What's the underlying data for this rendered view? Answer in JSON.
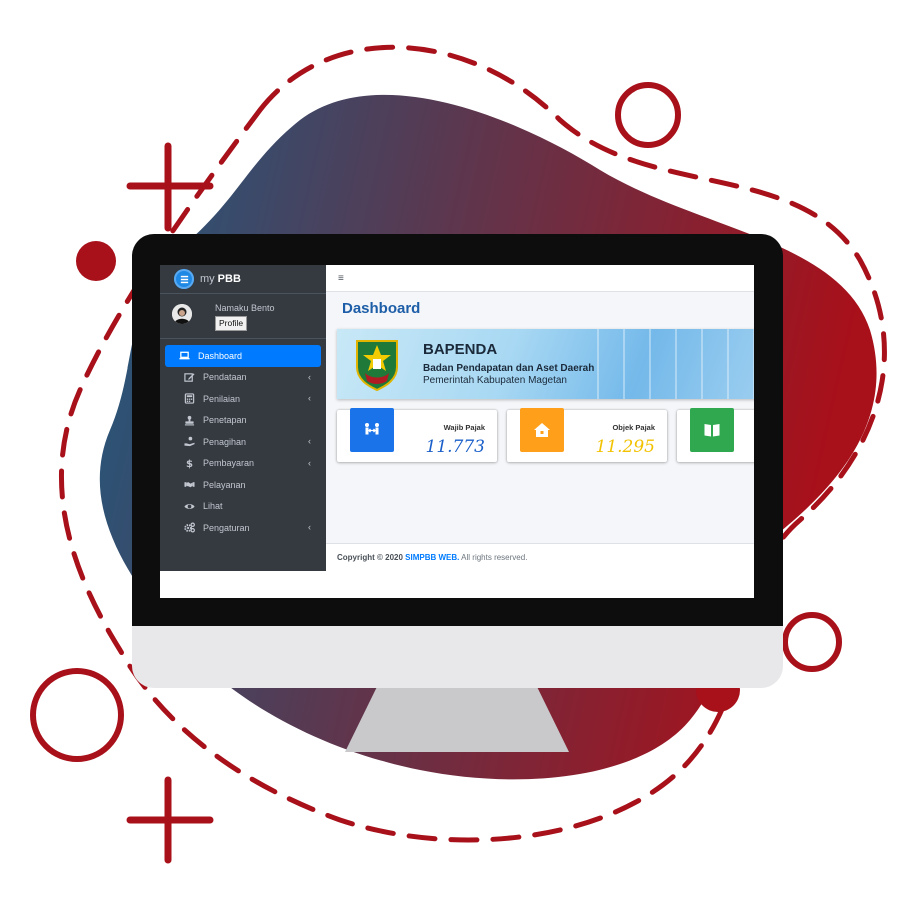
{
  "brand": {
    "prefix": "my",
    "name": "PBB"
  },
  "user": {
    "name": "Namaku Bento",
    "profile_label": "Profile"
  },
  "menu": [
    {
      "label": "Dashboard",
      "icon": "laptop-icon",
      "active": true,
      "chevron": false
    },
    {
      "label": "Pendataan",
      "icon": "edit-icon",
      "active": false,
      "chevron": true
    },
    {
      "label": "Penilaian",
      "icon": "calculator-icon",
      "active": false,
      "chevron": true
    },
    {
      "label": "Penetapan",
      "icon": "stamp-icon",
      "active": false,
      "chevron": false
    },
    {
      "label": "Penagihan",
      "icon": "hand-coin-icon",
      "active": false,
      "chevron": true
    },
    {
      "label": "Pembayaran",
      "icon": "dollar-icon",
      "active": false,
      "chevron": true
    },
    {
      "label": "Pelayanan",
      "icon": "handshake-icon",
      "active": false,
      "chevron": false
    },
    {
      "label": "Lihat",
      "icon": "eye-icon",
      "active": false,
      "chevron": false
    },
    {
      "label": "Pengaturan",
      "icon": "cogs-icon",
      "active": false,
      "chevron": true
    }
  ],
  "chevron_glyph": "‹",
  "topbar": {
    "menu_glyph": "≡"
  },
  "page": {
    "title": "Dashboard"
  },
  "banner": {
    "title": "BAPENDA",
    "subtitle": "Badan Pendapatan dan Aset Daerah",
    "subtitle2": "Pemerintah Kabupaten Magetan"
  },
  "stats": [
    {
      "label": "Wajib Pajak",
      "value": "11.773",
      "color": "#1a73e8",
      "value_color": "#1a5fc9",
      "icon": "people-arrows-icon"
    },
    {
      "label": "Objek Pajak",
      "value": "11.295",
      "color": "#ff9f1a",
      "value_color": "#f2c200",
      "icon": "house-icon"
    },
    {
      "label": "",
      "value": "",
      "color": "#2fa84f",
      "value_color": "#2fa84f",
      "icon": "book-icon"
    }
  ],
  "footer": {
    "prefix": "Copyright © 2020",
    "link": "SIMPBB WEB.",
    "suffix": "All rights reserved."
  },
  "colors": {
    "accent": "#007bff",
    "sidebar": "#343a40",
    "deco_red": "#a8101a",
    "blob_start": "#264f73",
    "blob_end": "#a01820"
  }
}
